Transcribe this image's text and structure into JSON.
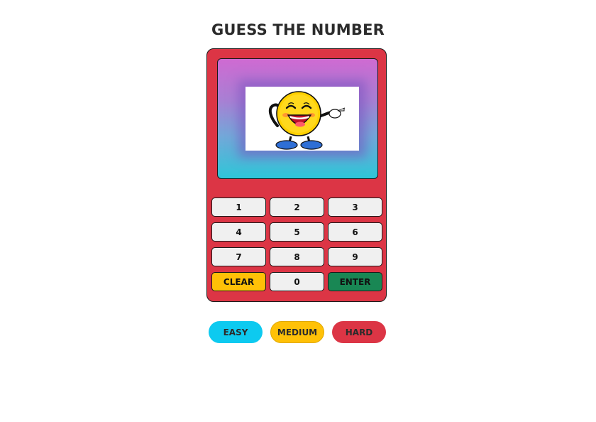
{
  "title": "GUESS THE NUMBER",
  "screen": {
    "image": "laughing-emoji-pointing",
    "gradient_top": "#cf6ad2",
    "gradient_bottom": "#2ec6d8"
  },
  "keypad": {
    "keys": [
      "1",
      "2",
      "3",
      "4",
      "5",
      "6",
      "7",
      "8",
      "9"
    ],
    "clear_label": "CLEAR",
    "zero_label": "0",
    "enter_label": "ENTER"
  },
  "levels": {
    "easy_label": "EASY",
    "medium_label": "MEDIUM",
    "hard_label": "HARD"
  },
  "colors": {
    "device": "#dc3545",
    "easy": "#0dcaf0",
    "medium": "#ffc107",
    "hard": "#dc3545",
    "enter": "#198754",
    "clear": "#ffc107"
  }
}
